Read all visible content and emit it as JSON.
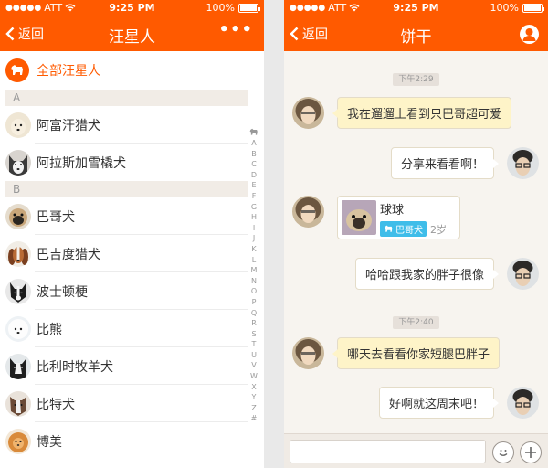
{
  "status_bar": {
    "carrier": "ATT",
    "time": "9:25 PM",
    "battery": "100%"
  },
  "left": {
    "back_label": "返回",
    "title": "汪星人",
    "more_label": "•••",
    "all_label": "全部汪星人",
    "sections": [
      {
        "letter": "A",
        "items": [
          {
            "name": "阿富汗猎犬"
          },
          {
            "name": "阿拉斯加雪橇犬"
          }
        ]
      },
      {
        "letter": "B",
        "items": [
          {
            "name": "巴哥犬"
          },
          {
            "name": "巴吉度猎犬"
          },
          {
            "name": "波士顿梗"
          },
          {
            "name": "比熊"
          },
          {
            "name": "比利时牧羊犬"
          },
          {
            "name": "比特犬"
          },
          {
            "name": "博美"
          }
        ]
      }
    ],
    "index_letters": [
      "A",
      "B",
      "C",
      "D",
      "E",
      "F",
      "G",
      "H",
      "I",
      "J",
      "K",
      "L",
      "M",
      "N",
      "O",
      "P",
      "Q",
      "R",
      "S",
      "T",
      "U",
      "V",
      "W",
      "X",
      "Y",
      "Z",
      "#"
    ]
  },
  "right": {
    "back_label": "返回",
    "title": "饼干",
    "messages": [
      {
        "kind": "time",
        "text": "下午2:29"
      },
      {
        "kind": "text",
        "from": "other",
        "text": "我在遛遛上看到只巴哥超可爱"
      },
      {
        "kind": "text",
        "from": "me",
        "text": "分享来看看啊！"
      },
      {
        "kind": "card",
        "from": "other",
        "name": "球球",
        "breed": "巴哥犬",
        "age": "2岁"
      },
      {
        "kind": "text",
        "from": "me",
        "text": "哈哈跟我家的胖子很像"
      },
      {
        "kind": "time",
        "text": "下午2:40"
      },
      {
        "kind": "text",
        "from": "other",
        "text": "哪天去看看你家短腿巴胖子"
      },
      {
        "kind": "text",
        "from": "me",
        "text": "好啊就这周末吧！"
      }
    ]
  },
  "colors": {
    "accent": "#ff5a00",
    "badge": "#3fbde9",
    "incoming_bubble": "#fef4c8"
  }
}
